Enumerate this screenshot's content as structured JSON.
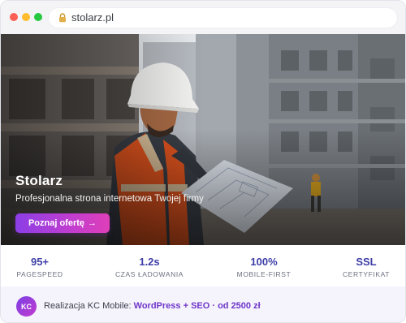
{
  "browser": {
    "url": "stolarz.pl",
    "icons": {
      "lock": "lock-icon"
    }
  },
  "hero": {
    "title": "Stolarz",
    "subtitle": "Profesjonalna strona internetowa Twojej firmy",
    "cta_label": "Poznaj ofertę",
    "cta_arrow": "→"
  },
  "stats": [
    {
      "value": "95+",
      "label": "PAGESPEED"
    },
    {
      "value": "1.2s",
      "label": "CZAS ŁADOWANIA"
    },
    {
      "value": "100%",
      "label": "MOBILE-FIRST"
    },
    {
      "value": "SSL",
      "label": "CERTYFIKAT"
    }
  ],
  "footer": {
    "badge": "KC",
    "prefix": "Realizacja KC Mobile: ",
    "highlight": "WordPress + SEO · od 2500 zł"
  },
  "colors": {
    "accent": "#3d3ea7",
    "cta_start": "#8b3ee6",
    "cta_end": "#de3fb8",
    "footer_highlight": "#6f35c9"
  }
}
